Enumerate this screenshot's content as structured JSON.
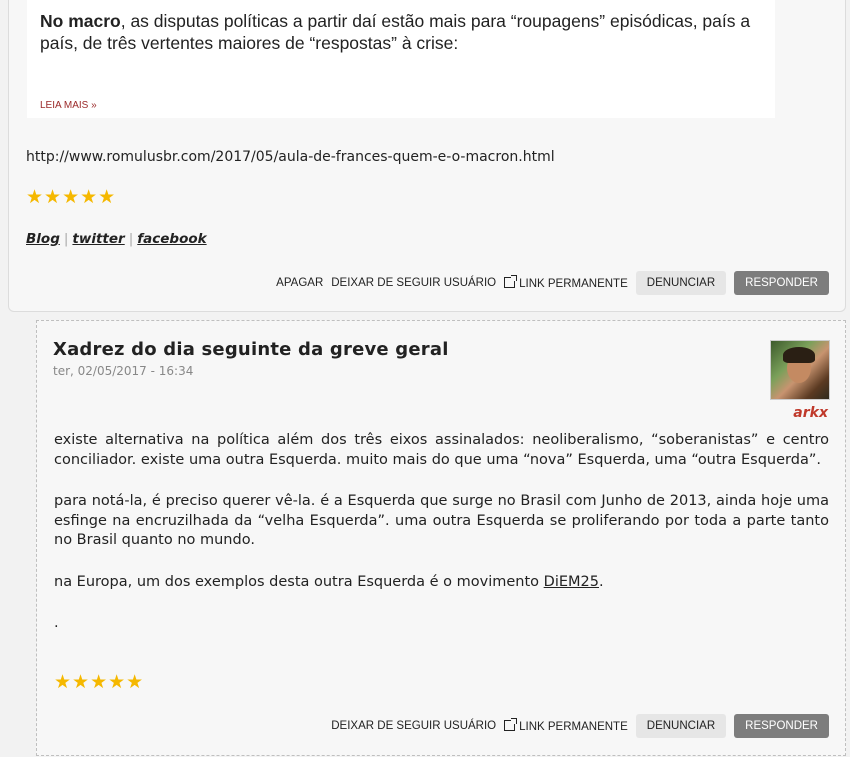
{
  "comment1": {
    "preview": {
      "bold_lead": "No macro",
      "text": ", as disputas políticas a partir daí estão mais para “roupagens” episódicas, país a país, de três vertentes maiores de “respostas” à crise:",
      "read_more": "LEIA MAIS »"
    },
    "url": "http://www.romulusbr.com/2017/05/aula-de-frances-quem-e-o-macron.html",
    "rating_stars": 5,
    "stars_text": "★★★★★",
    "links": [
      {
        "label": "Blog"
      },
      {
        "label": "twitter"
      },
      {
        "label": "facebook"
      }
    ],
    "separator": "|",
    "actions": {
      "delete": "APAGAR",
      "unfollow": "DEIXAR DE SEGUIR USUÁRIO",
      "permalink": "LINK PERMANENTE",
      "report": "DENUNCIAR",
      "reply": "RESPONDER"
    }
  },
  "comment2": {
    "title": "Xadrez do dia seguinte da greve geral",
    "date": "ter, 02/05/2017 - 16:34",
    "username": "arkx",
    "paragraphs": [
      "existe alternativa na política além dos três eixos assinalados: neoliberalismo, “soberanistas” e centro conciliador. existe uma outra Esquerda. muito mais do que uma “nova” Esquerda, uma “outra Esquerda”.",
      "para notá-la, é preciso querer vê-la. é a Esquerda que surge no Brasil com Junho de 2013, ainda hoje uma esfinge na encruzilhada da “velha Esquerda”. uma outra Esquerda se proliferando por toda a parte tanto no Brasil quanto no mundo."
    ],
    "p3_prefix": "na Europa, um dos exemplos desta outra Esquerda é o movimento ",
    "p3_link": "DiEM25",
    "p3_suffix": ".",
    "dot": ".",
    "rating_stars": 5,
    "stars_text": "★★★★★",
    "actions": {
      "unfollow": "DEIXAR DE SEGUIR USUÁRIO",
      "permalink": "LINK PERMANENTE",
      "report": "DENUNCIAR",
      "reply": "RESPONDER"
    }
  },
  "colors": {
    "star": "#f5b800",
    "username": "#c0392b",
    "read_more": "#9b2a2a",
    "reply_button": "#7d7d7d"
  }
}
